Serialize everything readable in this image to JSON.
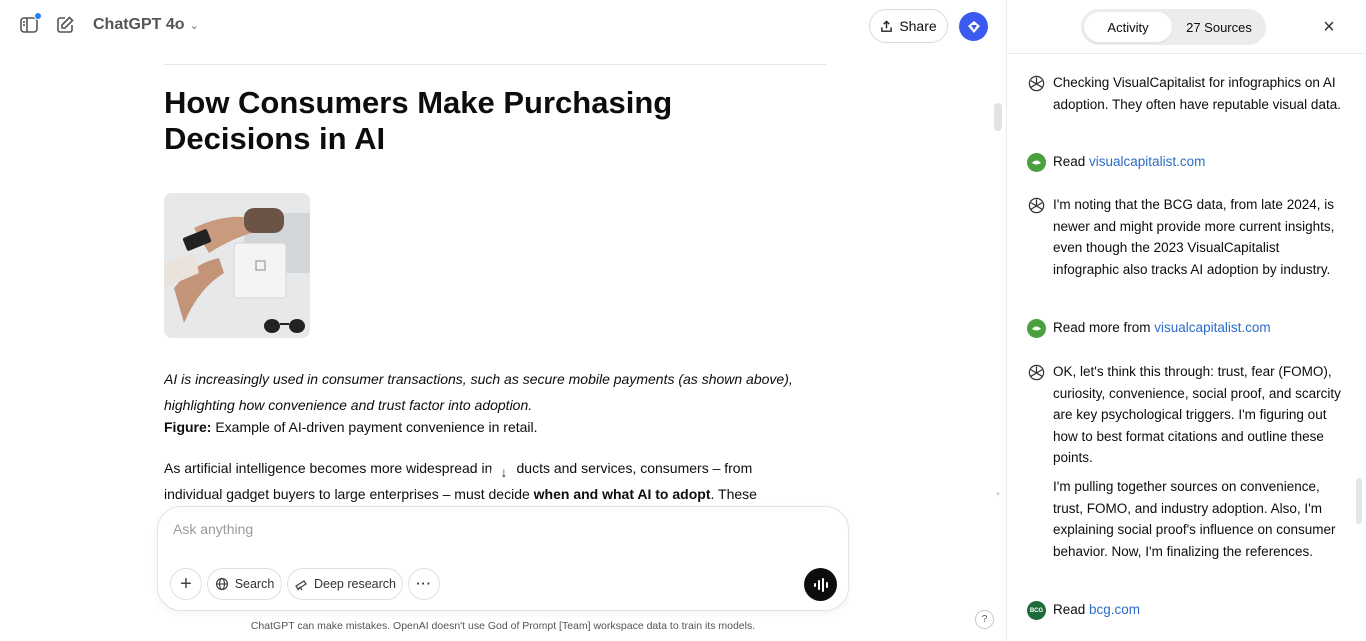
{
  "topbar": {
    "model_name": "ChatGPT 4o",
    "share_label": "Share"
  },
  "article": {
    "title": "How Consumers Make Purchasing Decisions in AI",
    "caption_line1": "AI is increasingly used in consumer transactions, such as secure mobile payments (as shown above),",
    "caption_line2": "highlighting how convenience and trust factor into adoption.",
    "figure_label": "Figure:",
    "figure_text": " Example of AI-driven payment convenience in retail.",
    "para_part1": "As artificial intelligence becomes more widespread in products and services, consumers – from individual gadget buyers to large enterprises – must decide ",
    "para_bold": "when and what AI to adopt",
    "para_part2": ". These"
  },
  "composer": {
    "placeholder": "Ask anything",
    "search_label": "Search",
    "deep_research_label": "Deep research",
    "disclaimer": "ChatGPT can make mistakes. OpenAI doesn't use God of Prompt [Team] workspace data to train its models."
  },
  "panel": {
    "tab_activity": "Activity",
    "tab_sources": "27 Sources",
    "items": [
      {
        "type": "thought",
        "text": "Checking VisualCapitalist for infographics on AI adoption. They often have reputable visual data."
      },
      {
        "type": "read",
        "prefix": "Read ",
        "link": "visualcapitalist.com"
      },
      {
        "type": "thought",
        "text": "I'm noting that the BCG data, from late 2024, is newer and might provide more current insights, even though the 2023 VisualCapitalist infographic also tracks AI adoption by industry."
      },
      {
        "type": "read",
        "prefix": "Read more from ",
        "link": "visualcapitalist.com"
      },
      {
        "type": "thought",
        "text": "OK, let's think this through: trust, fear (FOMO), curiosity, convenience, social proof, and scarcity are key psychological triggers. I'm figuring out how to best format citations and outline these points."
      },
      {
        "type": "thought-cont",
        "text": "I'm pulling together sources on convenience, trust, FOMO, and industry adoption. Also, I'm explaining social proof's influence on consumer behavior. Now, I'm finalizing the references."
      },
      {
        "type": "read",
        "prefix": "Read ",
        "link": "bcg.com",
        "badge": "BCG"
      }
    ]
  },
  "help_label": "?"
}
